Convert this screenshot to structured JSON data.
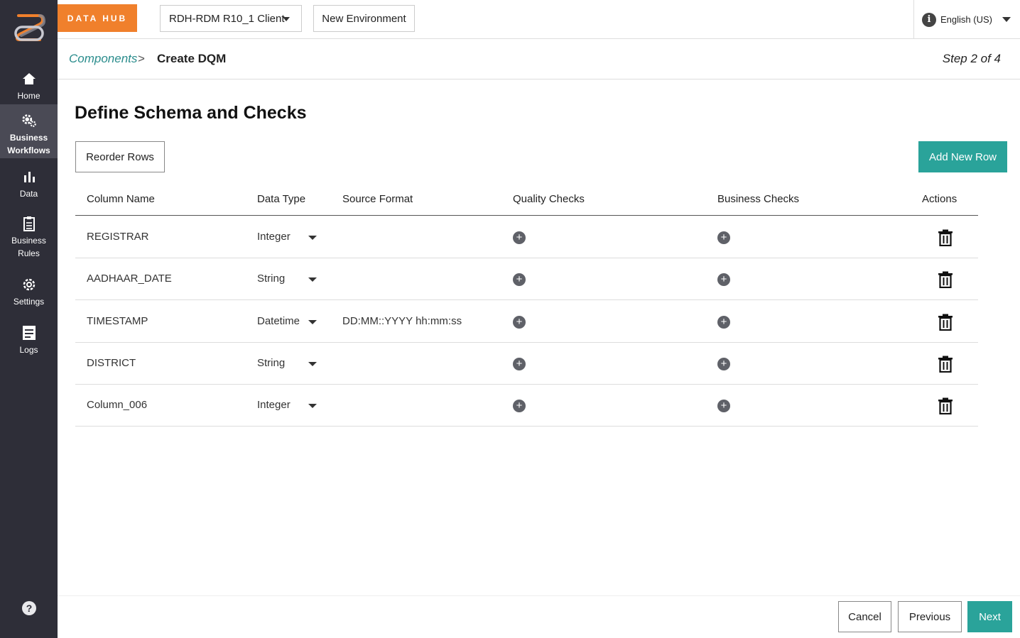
{
  "sidebar": {
    "items": [
      {
        "label": "Home",
        "icon": "home-icon"
      },
      {
        "label": "Business Workflows",
        "icon": "gears-icon"
      },
      {
        "label": "Data",
        "icon": "bar-chart-icon"
      },
      {
        "label": "Business Rules",
        "icon": "clipboard-icon"
      },
      {
        "label": "Settings",
        "icon": "gear-icon"
      },
      {
        "label": "Logs",
        "icon": "logs-icon"
      }
    ],
    "help_label": "?"
  },
  "header": {
    "brand": "DATA HUB",
    "client": "RDH-RDM R10_1 Client",
    "environment_button": "New Environment",
    "language": "English (US)"
  },
  "breadcrumb": {
    "parent": "Components",
    "separator": ">",
    "current": "Create DQM",
    "step": "Step 2 of 4"
  },
  "main": {
    "title": "Define Schema and Checks",
    "reorder_label": "Reorder Rows",
    "add_row_label": "Add New Row",
    "columns": [
      "Column Name",
      "Data Type",
      "Source Format",
      "Quality Checks",
      "Business Checks",
      "Actions"
    ],
    "rows": [
      {
        "name": "REGISTRAR",
        "type": "Integer",
        "format": ""
      },
      {
        "name": "AADHAAR_DATE",
        "type": "String",
        "format": ""
      },
      {
        "name": "TIMESTAMP",
        "type": "Datetime",
        "format": "DD:MM::YYYY hh:mm:ss"
      },
      {
        "name": "DISTRICT",
        "type": "String",
        "format": ""
      },
      {
        "name": "Column_006",
        "type": "Integer",
        "format": ""
      }
    ]
  },
  "footer": {
    "cancel": "Cancel",
    "previous": "Previous",
    "next": "Next"
  },
  "colors": {
    "sidebar": "#2e2e38",
    "brand": "#f0802c",
    "accent": "#2aa39a",
    "link": "#2a8c8c"
  }
}
